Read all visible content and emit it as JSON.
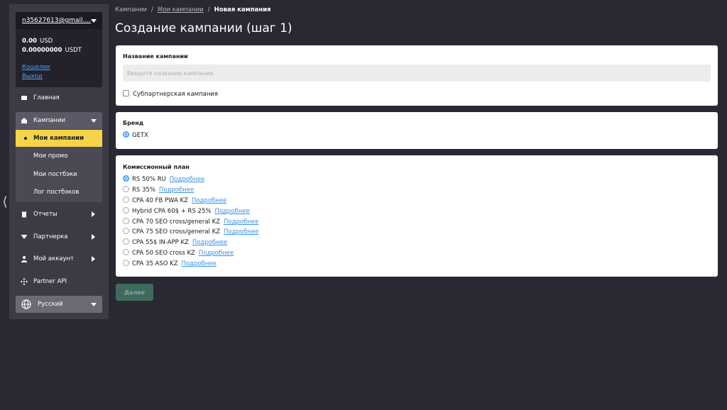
{
  "account": {
    "email": "n35627613@gmail....",
    "balance_usd": "0.00",
    "currency_usd": "USD",
    "balance_usdt": "0.00000000",
    "currency_usdt": "USDT",
    "wallet_link": "Кошелек",
    "logout_link": "Выход"
  },
  "sidebar": {
    "home": "Главная",
    "campaigns": "Кампании",
    "my_campaigns": "Мои кампании",
    "my_promo": "Мои промо",
    "my_postbacks": "Мои постбэки",
    "postback_log": "Лог постбэков",
    "reports": "Отчеты",
    "partnership": "Партнерка",
    "my_account": "Мой аккаунт",
    "partner_api": "Partner API",
    "language": "Русский"
  },
  "breadcrumb": {
    "root": "Кампании",
    "parent": "Мои кампании",
    "current": "Новая кампания",
    "separator": "/"
  },
  "page_title": "Создание кампании (шаг 1)",
  "campaign_name": {
    "label": "Название кампании",
    "placeholder": "Введите название кампании",
    "subpartner_label": "Субпартнерская кампания"
  },
  "brand": {
    "label": "Бренд",
    "option": "GETX"
  },
  "commission": {
    "label": "Комиссионный план",
    "more_label": "Подробнее",
    "plans": [
      "RS 50% RU",
      "RS 35%",
      "CPA 40 FB PWA KZ",
      "Hybrid CPA 60$ + RS 25%",
      "CPA 70 SEO cross/general KZ",
      "CPA 75 SEO cross/general KZ",
      "CPA 55$ IN-APP KZ",
      "CPA 50 SEO cross KZ",
      "CPA 35 ASO KZ"
    ]
  },
  "next_button": "Далее",
  "colors": {
    "background": "#2a2933",
    "sidebar": "#3b3a45",
    "active_item": "#f5d44a",
    "link": "#3a8ee8",
    "button": "#3f6b5f"
  }
}
